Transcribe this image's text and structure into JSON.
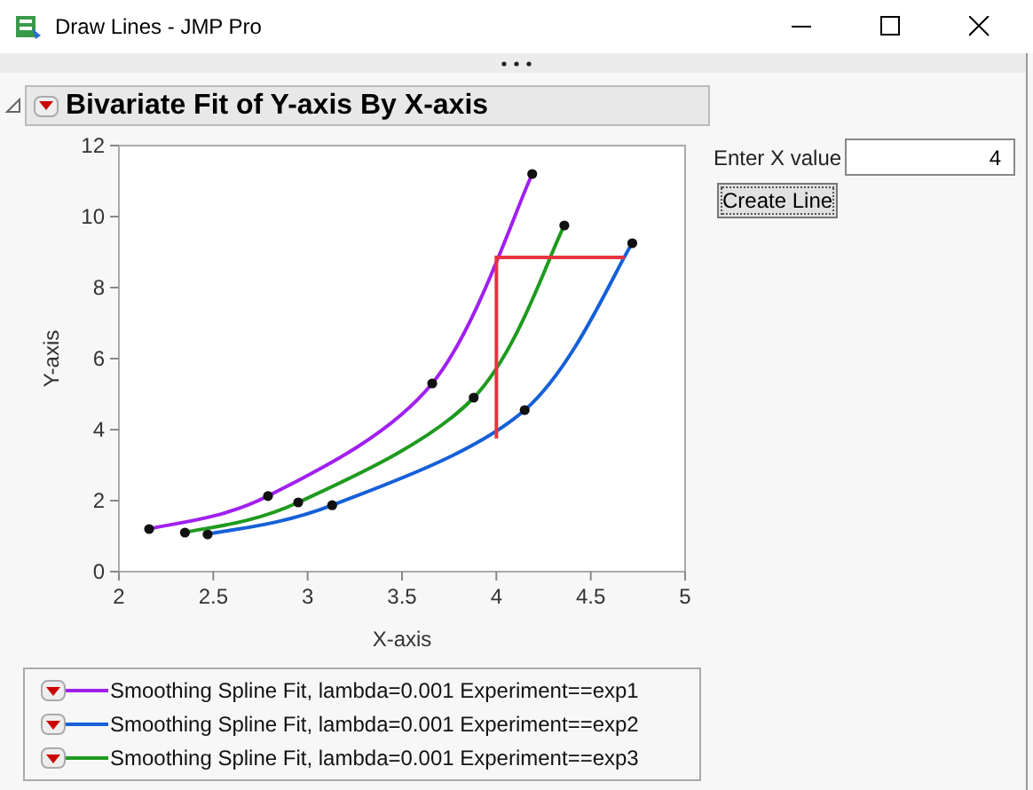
{
  "window": {
    "title": "Draw Lines - JMP Pro"
  },
  "report": {
    "title": "Bivariate Fit of Y-axis By X-axis",
    "expanded": true,
    "chart_data": {
      "type": "line",
      "xlabel": "X-axis",
      "ylabel": "Y-axis",
      "xlim": [
        2,
        5
      ],
      "ylim": [
        0,
        12
      ],
      "xticks": [
        2,
        {
          "value": 2.5,
          "label": "2.5"
        },
        3,
        {
          "value": 3.5,
          "label": "3.5"
        },
        4,
        {
          "value": 4.5,
          "label": "4.5"
        },
        5
      ],
      "yticks": [
        0,
        2,
        4,
        6,
        8,
        10,
        12
      ],
      "series": [
        {
          "name": "Smoothing Spline Fit, lambda=0.001 Experiment==exp1",
          "color": "#a020f0",
          "marker": true,
          "x": [
            2.16,
            2.79,
            3.66,
            4.19
          ],
          "values": [
            1.2,
            2.13,
            5.3,
            11.2
          ]
        },
        {
          "name": "Smoothing Spline Fit, lambda=0.001 Experiment==exp2",
          "color": "#1560d8",
          "marker": true,
          "x": [
            2.47,
            3.13,
            4.15,
            4.72
          ],
          "values": [
            1.05,
            1.87,
            4.55,
            9.25
          ]
        },
        {
          "name": "Smoothing Spline Fit, lambda=0.001 Experiment==exp3",
          "color": "#1f9a1f",
          "marker": true,
          "x": [
            2.35,
            2.95,
            3.88,
            4.36
          ],
          "values": [
            1.1,
            1.95,
            4.9,
            9.75
          ]
        },
        {
          "color": "#e8333f",
          "marker": false,
          "x": [
            4,
            4,
            4.68
          ],
          "values": [
            3.75,
            8.85,
            8.85
          ]
        }
      ]
    },
    "x_input": {
      "label": "Enter X value",
      "value": "4"
    },
    "button": "Create Line"
  }
}
